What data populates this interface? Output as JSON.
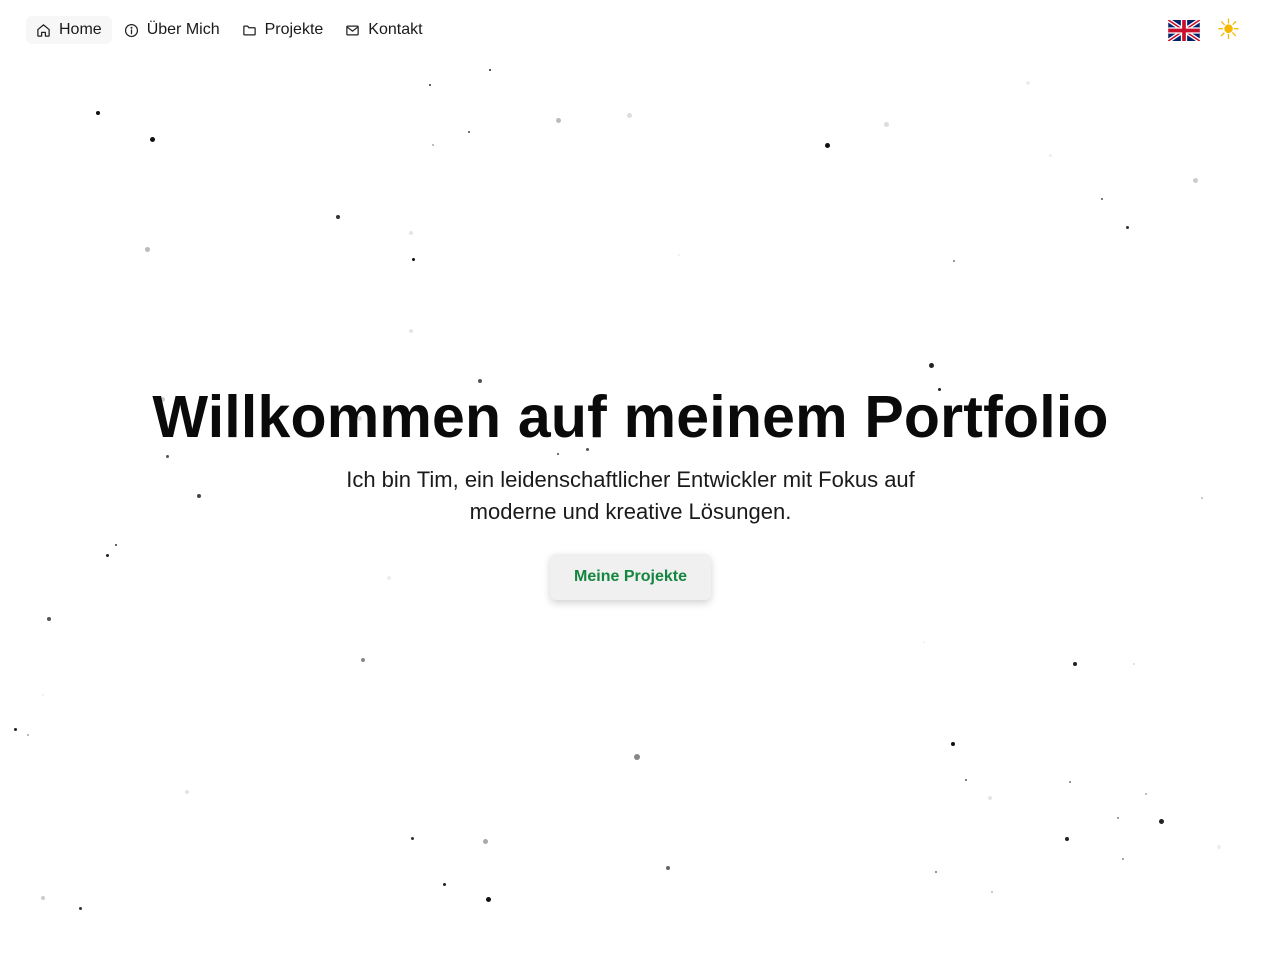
{
  "nav": {
    "items": [
      {
        "label": "Home",
        "icon": "home-icon",
        "active": true
      },
      {
        "label": "Über Mich",
        "icon": "info-icon",
        "active": false
      },
      {
        "label": "Projekte",
        "icon": "folder-icon",
        "active": false
      },
      {
        "label": "Kontakt",
        "icon": "mail-icon",
        "active": false
      }
    ],
    "language_icon": "uk-flag-icon",
    "theme_icon": "sun-icon",
    "theme_symbol": "☀"
  },
  "hero": {
    "title": "Willkommen auf meinem Portfolio",
    "subtitle": "Ich bin Tim, ein leidenschaftlicher Entwickler mit Fokus auf moderne und kreative Lösungen.",
    "button_label": "Meine Projekte"
  },
  "colors": {
    "background": "#ffffff",
    "button_text": "#15863f",
    "button_bg": "#f0f0f0",
    "sun": "#f5b800"
  }
}
